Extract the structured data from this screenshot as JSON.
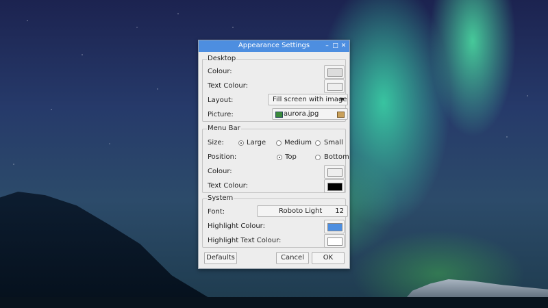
{
  "window": {
    "title": "Appearance Settings"
  },
  "desktop": {
    "group_label": "Desktop",
    "colour_label": "Colour:",
    "colour_value": "#dcdcdc",
    "text_colour_label": "Text Colour:",
    "text_colour_value": "#eeeeee",
    "layout_label": "Layout:",
    "layout_value": "Fill screen with image",
    "picture_label": "Picture:",
    "picture_value": "aurora.jpg"
  },
  "menu_bar": {
    "group_label": "Menu Bar",
    "size_label": "Size:",
    "size_options": [
      "Large",
      "Medium",
      "Small"
    ],
    "size_selected": "Large",
    "position_label": "Position:",
    "position_options": [
      "Top",
      "Bottom"
    ],
    "position_selected": "Top",
    "colour_label": "Colour:",
    "colour_value": "#eeeeee",
    "text_colour_label": "Text Colour:",
    "text_colour_value": "#000000"
  },
  "system": {
    "group_label": "System",
    "font_label": "Font:",
    "font_name": "Roboto Light",
    "font_size": "12",
    "highlight_colour_label": "Highlight Colour:",
    "highlight_colour_value": "#4d8ee0",
    "highlight_text_colour_label": "Highlight Text Colour:",
    "highlight_text_colour_value": "#ffffff"
  },
  "buttons": {
    "defaults": "Defaults",
    "cancel": "Cancel",
    "ok": "OK"
  }
}
